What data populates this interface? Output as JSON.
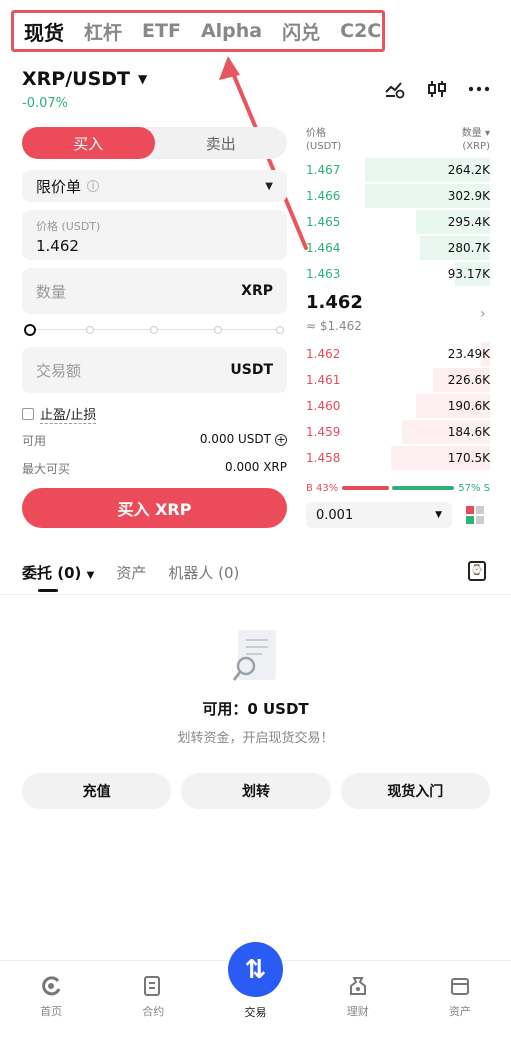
{
  "top_tabs": [
    "现货",
    "杠杆",
    "ETF",
    "Alpha",
    "闪兑",
    "C2C"
  ],
  "pair": {
    "name": "XRP/USDT",
    "change": "-0.07%"
  },
  "buy_sell": {
    "buy": "买入",
    "sell": "卖出"
  },
  "order_type": "限价单",
  "price_field": {
    "label": "价格 (USDT)",
    "value": "1.462"
  },
  "qty_field": {
    "placeholder": "数量",
    "unit": "XRP"
  },
  "amount_field": {
    "placeholder": "交易额",
    "unit": "USDT"
  },
  "slider": {
    "value": 0
  },
  "tpsl_label": "止盈/止损",
  "available": {
    "label": "可用",
    "value": "0.000 USDT"
  },
  "max_buy": {
    "label": "最大可买",
    "value": "0.000 XRP"
  },
  "buy_button": "买入 XRP",
  "orderbook": {
    "head_price": "价格",
    "head_price_unit": "(USDT)",
    "head_qty": "数量",
    "head_qty_unit": "(XRP)",
    "asks": [
      {
        "price": "1.467",
        "qty": "264.2K",
        "depth": 0.68
      },
      {
        "price": "1.466",
        "qty": "302.9K",
        "depth": 0.68
      },
      {
        "price": "1.465",
        "qty": "295.4K",
        "depth": 0.4
      },
      {
        "price": "1.464",
        "qty": "280.7K",
        "depth": 0.38
      },
      {
        "price": "1.463",
        "qty": "93.17K",
        "depth": 0.19
      }
    ],
    "mid_price": "1.462",
    "mid_usd": "≈ $1.462",
    "bids": [
      {
        "price": "1.462",
        "qty": "23.49K",
        "depth": 0.05
      },
      {
        "price": "1.461",
        "qty": "226.6K",
        "depth": 0.31
      },
      {
        "price": "1.460",
        "qty": "190.6K",
        "depth": 0.4
      },
      {
        "price": "1.459",
        "qty": "184.6K",
        "depth": 0.48
      },
      {
        "price": "1.458",
        "qty": "170.5K",
        "depth": 0.54
      }
    ],
    "buy_ratio": "B 43%",
    "sell_ratio": "57% S",
    "buy_pct": 43,
    "precision": "0.001"
  },
  "orders_tabs": [
    "委托 (0)",
    "资产",
    "机器人 (0)"
  ],
  "empty": {
    "title": "可用：0 USDT",
    "subtitle": "划转资金，开启现货交易！"
  },
  "actions": [
    "充值",
    "划转",
    "现货入门"
  ],
  "bottom_nav": [
    "首页",
    "合约",
    "交易",
    "理财",
    "资产"
  ],
  "colors": {
    "buy": "#ec4b59",
    "green": "#2db07a",
    "trade_blue": "#2a5cf5",
    "highlight_box": "#e8555d"
  }
}
